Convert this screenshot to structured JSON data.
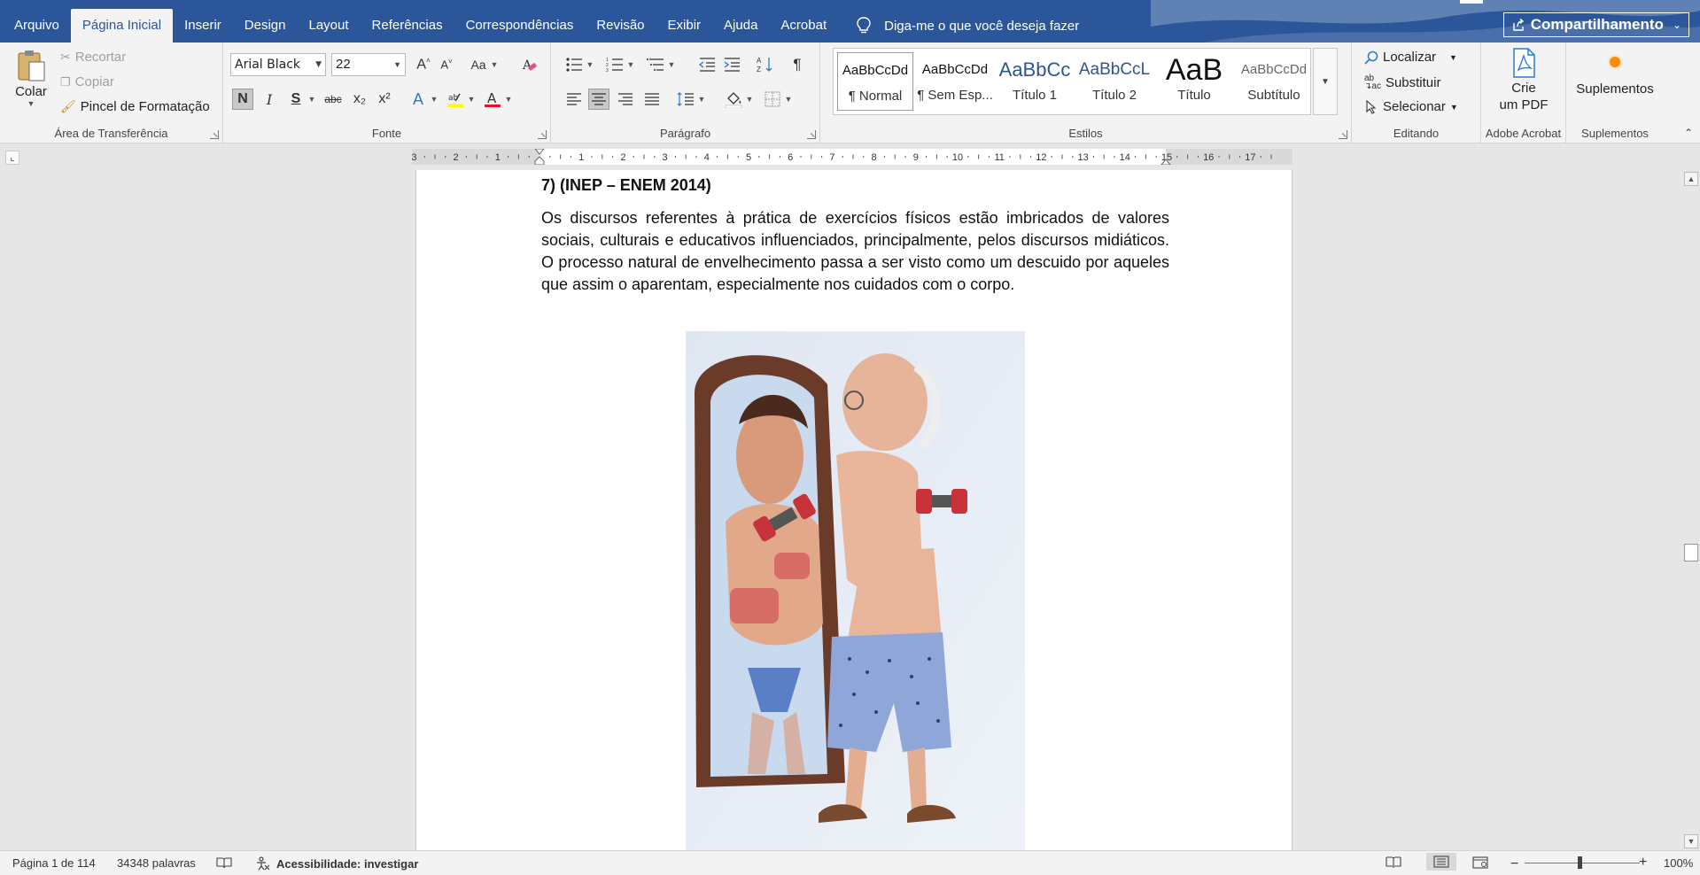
{
  "tabs": [
    "Arquivo",
    "Página Inicial",
    "Inserir",
    "Design",
    "Layout",
    "Referências",
    "Correspondências",
    "Revisão",
    "Exibir",
    "Ajuda",
    "Acrobat"
  ],
  "active_tab": "Página Inicial",
  "tell_me": "Diga-me o que você deseja fazer",
  "share_label": "Compartilhamento",
  "clipboard": {
    "paste": "Colar",
    "cut": "Recortar",
    "copy": "Copiar",
    "format_painter": "Pincel de Formatação",
    "label": "Área de Transferência"
  },
  "font": {
    "name": "Arial Black",
    "size": "22",
    "case_btn": "Aa",
    "bold": "N",
    "italic": "I",
    "underline": "S",
    "strike": "abc",
    "subscript": "x₂",
    "superscript": "x²",
    "label": "Fonte",
    "font_color": "#e81123",
    "highlight_color": "#ffff00"
  },
  "paragraph": {
    "label": "Parágrafo"
  },
  "styles": {
    "label": "Estilos",
    "items": [
      {
        "sample": "AaBbCcDd",
        "name": "¶ Normal"
      },
      {
        "sample": "AaBbCcDd",
        "name": "¶ Sem Esp..."
      },
      {
        "sample": "AaBbCc",
        "name": "Título 1"
      },
      {
        "sample": "AaBbCcL",
        "name": "Título 2"
      },
      {
        "sample": "AaB",
        "name": "Título"
      },
      {
        "sample": "AaBbCcDd",
        "name": "Subtítulo"
      }
    ]
  },
  "editing": {
    "label": "Editando",
    "find": "Localizar",
    "replace": "Substituir",
    "select": "Selecionar"
  },
  "acrobat": {
    "create_line1": "Crie",
    "create_line2": "um PDF",
    "label": "Adobe Acrobat"
  },
  "addins": {
    "button": "Suplementos",
    "label": "Suplementos"
  },
  "ruler_numbers": [
    "3",
    "2",
    "1",
    "1",
    "2",
    "3",
    "4",
    "5",
    "6",
    "7",
    "8",
    "9",
    "10",
    "11",
    "12",
    "13",
    "14",
    "15",
    "16",
    "17"
  ],
  "document": {
    "question_title": "7) (INEP – ENEM 2014)",
    "paragraph": "Os discursos referentes à prática de exercícios físicos estão imbricados de valores sociais, culturais e educativos influenciados, principalmente, pelos discursos midiáticos. O processo natural de envelhecimento passa a ser visto como um descuido por aqueles que assim o aparentam, especialmente nos cuidados com o corpo."
  },
  "status": {
    "page": "Página 1 de 114",
    "words": "34348 palavras",
    "accessibility": "Acessibilidade: investigar",
    "zoom": "100%"
  }
}
